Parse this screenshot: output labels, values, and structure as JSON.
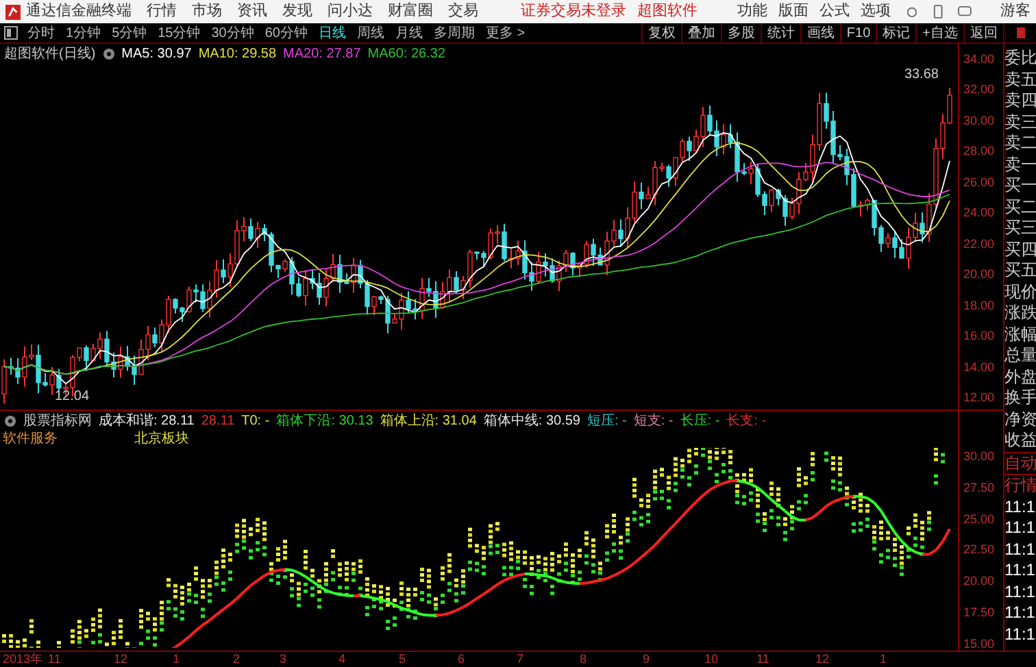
{
  "app": {
    "title": "通达信金融终端",
    "menus": [
      "行情",
      "市场",
      "资讯",
      "发现",
      "问小达",
      "财富圈",
      "交易"
    ],
    "notices": [
      "证券交易未登录",
      "超图软件"
    ],
    "right_menus": [
      "功能",
      "版面",
      "公式",
      "选项"
    ],
    "user": "游客"
  },
  "periods": [
    {
      "label": "分时",
      "selected": false
    },
    {
      "label": "1分钟",
      "selected": false
    },
    {
      "label": "5分钟",
      "selected": false
    },
    {
      "label": "15分钟",
      "selected": false
    },
    {
      "label": "30分钟",
      "selected": false
    },
    {
      "label": "60分钟",
      "selected": false
    },
    {
      "label": "日线",
      "selected": true
    },
    {
      "label": "周线",
      "selected": false
    },
    {
      "label": "月线",
      "selected": false
    },
    {
      "label": "多周期",
      "selected": false
    },
    {
      "label": "更多 >",
      "selected": false
    }
  ],
  "tools": [
    "复权",
    "叠加",
    "多股",
    "统计",
    "画线",
    "F10",
    "标记",
    "+自选",
    "返回"
  ],
  "main_chart": {
    "title": "超图软件(日线)",
    "averages": [
      {
        "text": "MA5: 30.97",
        "color": "#ffffff"
      },
      {
        "text": "MA10: 29.58",
        "color": "#e0e040"
      },
      {
        "text": "MA20: 27.87",
        "color": "#e040e0"
      },
      {
        "text": "MA60: 26.32",
        "color": "#30c030"
      }
    ],
    "high_label": "33.68",
    "low_label": "12.04",
    "axis": [
      "34.00",
      "32.00",
      "30.00",
      "28.00",
      "26.00",
      "24.00",
      "22.00",
      "20.00",
      "18.00",
      "16.00",
      "14.00",
      "12.00"
    ]
  },
  "indicator": {
    "source": "股票指标网",
    "items": [
      {
        "text": "成本和谐: 28.11",
        "color": "#e8e8e8"
      },
      {
        "text": "28.11",
        "color": "#e03030"
      },
      {
        "text": "T0: -",
        "color": "#e0e040"
      },
      {
        "text": "箱体下沿: 30.13",
        "color": "#30d030"
      },
      {
        "text": "箱体上沿: 31.04",
        "color": "#e0e040"
      },
      {
        "text": "箱体中线: 30.59",
        "color": "#e8e8e8"
      },
      {
        "text": "短压: -",
        "color": "#30c0c0"
      },
      {
        "text": "短支: -",
        "color": "#e080a0"
      },
      {
        "text": "长压: -",
        "color": "#30d030"
      },
      {
        "text": "长支: -",
        "color": "#e03030"
      }
    ],
    "sector": "软件服务",
    "region": "北京板块",
    "axis": [
      "30.00",
      "27.50",
      "25.00",
      "22.50",
      "20.00",
      "17.50",
      "15.00"
    ]
  },
  "quote_panel": [
    "委比",
    "卖五",
    "卖四",
    "卖三",
    "卖二",
    "卖一",
    "买一",
    "买二",
    "买三",
    "买四",
    "买五",
    "现价",
    "涨跌",
    "涨幅",
    "总量",
    "外盘",
    "换手",
    "净资",
    "收益",
    "自动",
    "行情",
    "11:1",
    "11:1",
    "11:1",
    "11:1",
    "11:1",
    "11:1",
    "11:1"
  ],
  "date_axis": [
    "2013年",
    "11",
    "12",
    "1",
    "2",
    "3",
    "4",
    "5",
    "6",
    "7",
    "8",
    "9",
    "10",
    "11",
    "12",
    "1"
  ]
}
